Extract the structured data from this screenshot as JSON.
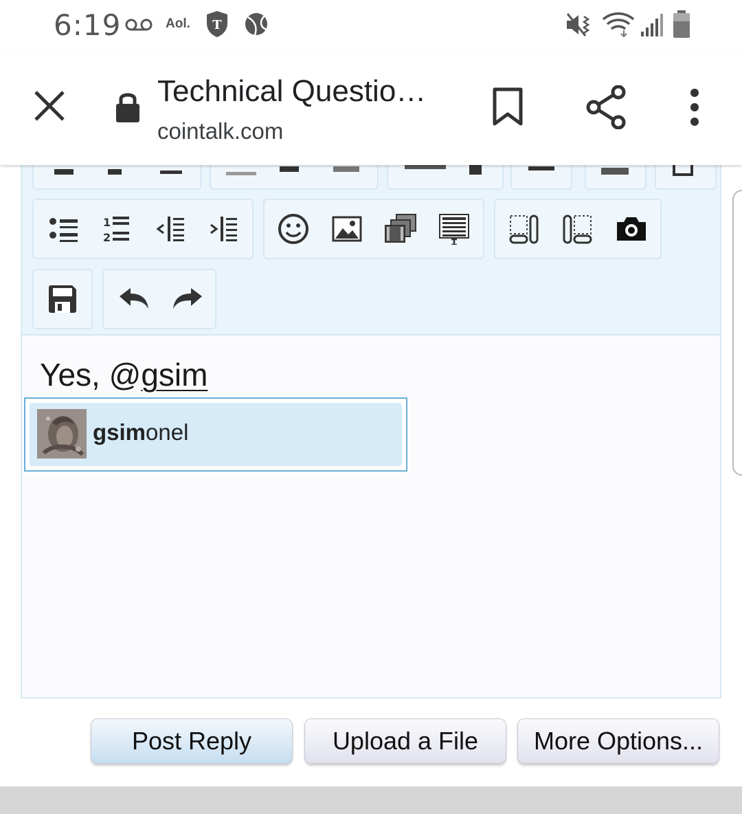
{
  "status_bar": {
    "time": "6:19",
    "carrier_label": "Aol.",
    "icons": [
      "voicemail-icon",
      "aol-icon",
      "t-mobile-shield-icon",
      "sports-ball-icon",
      "mute-vibrate-icon",
      "wifi-icon",
      "signal-icon",
      "battery-icon"
    ]
  },
  "browser": {
    "title": "Technical Questio…",
    "domain": "cointalk.com",
    "icons": [
      "close-icon",
      "lock-icon",
      "bookmark-icon",
      "share-icon",
      "more-vert-icon"
    ]
  },
  "editor": {
    "toolbar_icons": [
      "bulleted-list-icon",
      "numbered-list-icon",
      "outdent-icon",
      "indent-icon",
      "smilie-icon",
      "image-icon",
      "media-icon",
      "insert-text-icon",
      "align-left-float-icon",
      "align-right-float-icon",
      "camera-icon",
      "save-draft-icon",
      "undo-icon",
      "redo-icon"
    ],
    "content_prefix": "Yes, @",
    "content_mention": "gsim",
    "colors": {
      "toolbar_bg": "#eaf4fb",
      "group_border": "#d5e8f3",
      "highlight": "#d7eaf8",
      "focus_border": "#6aaed6"
    }
  },
  "autocomplete": {
    "match": "gsim",
    "rest": "onel",
    "avatar": "coin-avatar"
  },
  "buttons": {
    "post_reply": "Post Reply",
    "upload": "Upload a File",
    "more_options": "More Options..."
  }
}
